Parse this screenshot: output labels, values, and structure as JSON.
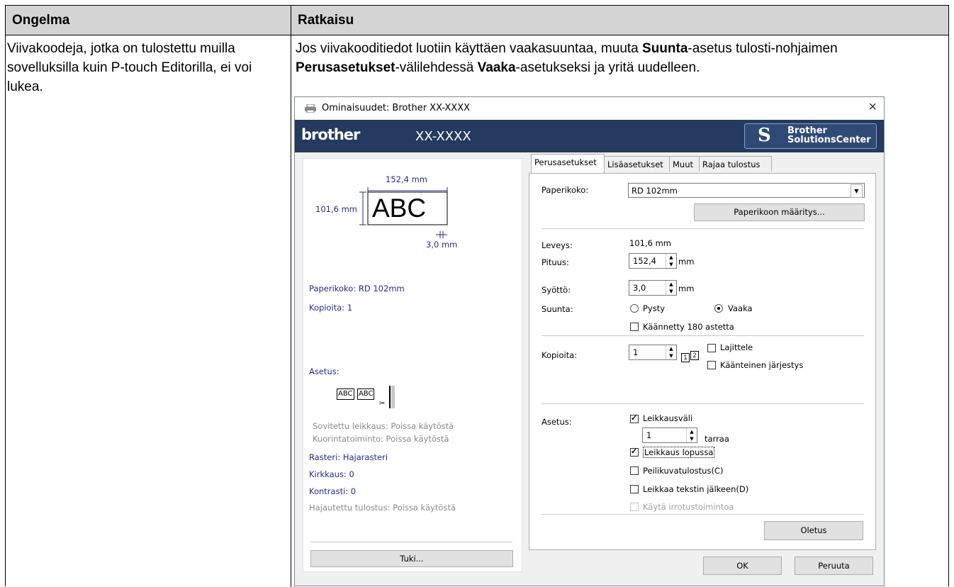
{
  "table": {
    "col1_header": "Ongelma",
    "col2_header": "Ratkaisu",
    "problem_text": "Viivakoodeja, jotka on tulostettu muilla sovelluksilla kuin P-touch Editorilla, ei voi lukea.",
    "solution_part1": "Jos viivakooditiedot luotiin käyttäen vaakasuuntaa, muuta ",
    "solution_bold1": "Suunta",
    "solution_part2": "-asetus tulosti-nohjaimen ",
    "solution_bold2": "Perusasetukset",
    "solution_part3": "-välilehdessä ",
    "solution_bold3": "Vaaka",
    "solution_part4": "-asetukseksi ja yritä uudelleen."
  },
  "dialog": {
    "title": "Ominaisuudet: Brother XX-XXXX",
    "close_glyph": "×",
    "brand": "brother",
    "model": "XX-XXXX",
    "solutions_center": {
      "line1": "Brother",
      "line2": "SolutionsCenter",
      "glyph": "S"
    },
    "preview": {
      "width_dim": "152,4 mm",
      "height_dim": "101,6 mm",
      "sample": "ABC",
      "feed_dim": "3,0 mm",
      "paper_size": "Paperikoko: RD 102mm",
      "copies": "Kopioita: 1",
      "setting_label": "Asetus:",
      "mini_labels": [
        "ABC",
        "ABC"
      ],
      "fitted_cut": "Sovitettu leikkaus: Poissa käytöstä",
      "peel_function": "Kuorintatoiminto: Poissa käytöstä",
      "raster": "Rasteri: Hajarasteri",
      "brightness": "Kirkkaus:  0",
      "contrast": "Kontrasti:  0",
      "distributed_print": "Hajautettu tulostus: Poissa käytöstä",
      "support_button": "Tuki..."
    },
    "tabs": [
      "Perusasetukset",
      "Lisäasetukset",
      "Muut",
      "Rajaa tulostus"
    ],
    "basic": {
      "paper_size_label": "Paperikoko:",
      "paper_size_value": "RD 102mm",
      "paper_define_button": "Paperikoon määritys...",
      "width_label": "Leveys:",
      "width_value": "101,6 mm",
      "length_label": "Pituus:",
      "length_value": "152,4",
      "length_unit": "mm",
      "feed_label": "Syöttö:",
      "feed_value": "3,0",
      "feed_unit": "mm",
      "orientation_label": "Suunta:",
      "orientation_portrait": "Pysty",
      "orientation_landscape": "Vaaka",
      "orientation_selected": "Vaaka",
      "rotated_180": "Käännetty 180 astetta",
      "copies_label": "Kopioita:",
      "copies_value": "1",
      "collate": "Lajittele",
      "reverse_order": "Käänteinen järjestys",
      "collate_icon_digits": [
        "1",
        "2"
      ],
      "setting_label": "Asetus:",
      "cut_interval": "Leikkausväli",
      "cut_interval_checked": true,
      "cut_every_value": "1",
      "cut_every_unit": "tarraa",
      "cut_at_end": "Leikkaus lopussa",
      "cut_at_end_checked": true,
      "mirror_print": "Peilikuvatulostus(C)",
      "cut_after_text": "Leikkaa tekstin jälkeen(D)",
      "use_peel": "Käytä irrotustoimintoa",
      "default_button": "Oletus"
    },
    "ok_button": "OK",
    "cancel_button": "Peruuta"
  }
}
